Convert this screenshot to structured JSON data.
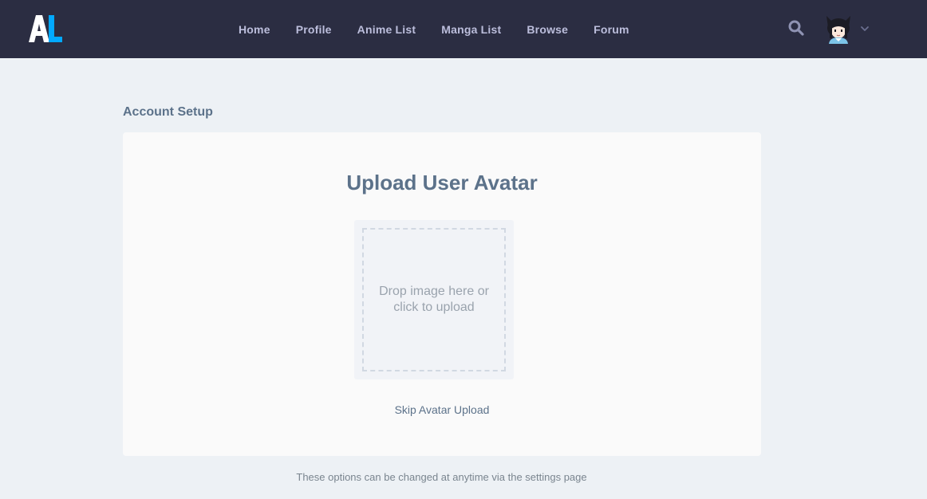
{
  "colors": {
    "navbar_bg": "#2b2d42",
    "page_bg": "#edf1f5",
    "logo_white": "#ffffff",
    "logo_blue": "#02a9ff",
    "nav_text": "#bcbedc",
    "heading_text": "#5c728a"
  },
  "header": {
    "logo_text": "AL",
    "nav": [
      {
        "label": "Home"
      },
      {
        "label": "Profile"
      },
      {
        "label": "Anime List"
      },
      {
        "label": "Manga List"
      },
      {
        "label": "Browse"
      },
      {
        "label": "Forum"
      }
    ],
    "icons": [
      "search-icon",
      "avatar",
      "chevron-down-icon"
    ]
  },
  "main": {
    "section_title": "Account Setup",
    "card": {
      "title": "Upload User Avatar",
      "dropzone_text": "Drop image here or click to upload",
      "skip_label": "Skip Avatar Upload"
    },
    "footer_note": "These options can be changed at anytime via the settings page"
  }
}
